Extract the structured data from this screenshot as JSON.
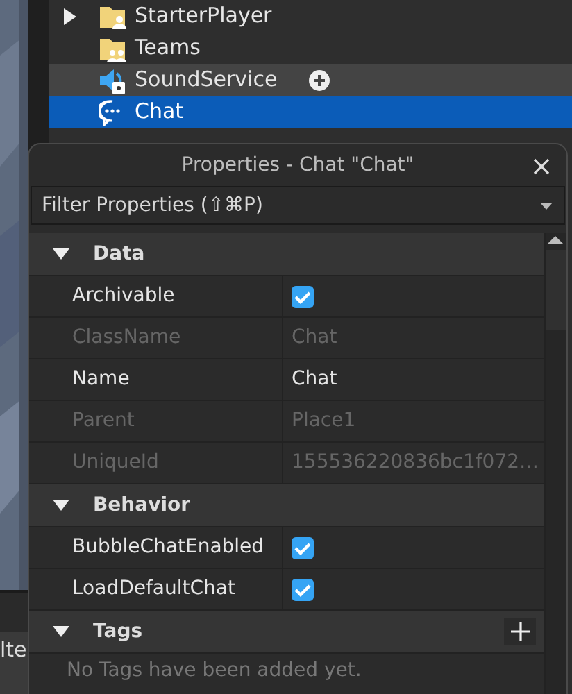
{
  "explorer": {
    "items": [
      {
        "label": "StarterPlayer",
        "kind": "folder-player",
        "has_children": true,
        "selected": false,
        "hovered": false
      },
      {
        "label": "Teams",
        "kind": "folder-teams",
        "has_children": false,
        "selected": false,
        "hovered": false
      },
      {
        "label": "SoundService",
        "kind": "sound",
        "has_children": false,
        "selected": false,
        "hovered": true
      },
      {
        "label": "Chat",
        "kind": "chat",
        "has_children": false,
        "selected": true,
        "hovered": false
      }
    ]
  },
  "background_field": {
    "text": "lte"
  },
  "properties": {
    "title": "Properties - Chat \"Chat\"",
    "filter": {
      "placeholder": "Filter Properties (⇧⌘P)"
    },
    "sections": [
      {
        "title": "Data",
        "expanded": true,
        "rows": [
          {
            "name": "Archivable",
            "kind": "checkbox",
            "checked": true,
            "disabled": false
          },
          {
            "name": "ClassName",
            "kind": "text",
            "value": "Chat",
            "disabled": true
          },
          {
            "name": "Name",
            "kind": "text",
            "value": "Chat",
            "disabled": false
          },
          {
            "name": "Parent",
            "kind": "text",
            "value": "Place1",
            "disabled": true
          },
          {
            "name": "UniqueId",
            "kind": "text",
            "value": "155536220836bc1f072…",
            "disabled": true
          }
        ]
      },
      {
        "title": "Behavior",
        "expanded": true,
        "rows": [
          {
            "name": "BubbleChatEnabled",
            "kind": "checkbox",
            "checked": true,
            "disabled": false
          },
          {
            "name": "LoadDefaultChat",
            "kind": "checkbox",
            "checked": true,
            "disabled": false
          }
        ]
      },
      {
        "title": "Tags",
        "expanded": true,
        "addable": true,
        "empty_message": "No Tags have been added yet."
      }
    ]
  }
}
